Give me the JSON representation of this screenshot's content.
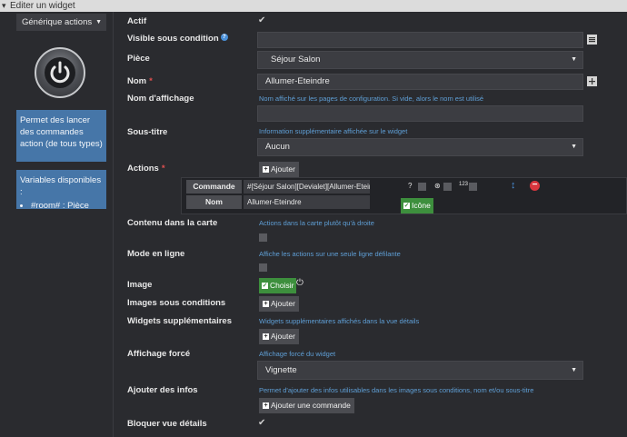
{
  "title": "Editer un widget",
  "sidebar": {
    "type_select": "Générique actions",
    "description": "Permet des lancer des commandes action (de tous types)",
    "variables_title": "Variables disponibles :",
    "variables": [
      "#room# : Pièce"
    ]
  },
  "form": {
    "actif": {
      "label": "Actif"
    },
    "visible": {
      "label": "Visible sous condition",
      "value": ""
    },
    "piece": {
      "label": "Pièce",
      "value": "Séjour Salon"
    },
    "nom": {
      "label": "Nom",
      "required": "*",
      "value": "Allumer-Eteindre"
    },
    "nom_affichage": {
      "label": "Nom d'affichage",
      "hint": "Nom affiché sur les pages de configuration. Si vide, alors le nom est utilisé",
      "value": ""
    },
    "sous_titre": {
      "label": "Sous-titre",
      "hint": "Information supplémentaire affichée sur le widget",
      "value": "Aucun"
    },
    "actions": {
      "label": "Actions",
      "required": "*",
      "add_label": "Ajouter",
      "commande_label": "Commande",
      "commande_value": "#[Séjour Salon][Devialet][Allumer-Eteindre]#",
      "nom_label": "Nom",
      "nom_value": "Allumer-Eteindre",
      "icone_label": "Icône",
      "count_label": "123"
    },
    "contenu": {
      "label": "Contenu dans la carte",
      "hint": "Actions dans la carte plutôt qu'à droite"
    },
    "mode_ligne": {
      "label": "Mode en ligne",
      "hint": "Affiche les actions sur une seule ligne défilante"
    },
    "image": {
      "label": "Image",
      "choose_label": "Choisir"
    },
    "images_cond": {
      "label": "Images sous conditions",
      "add_label": "Ajouter"
    },
    "widgets_supp": {
      "label": "Widgets supplémentaires",
      "hint": "Widgets supplémentaires affichés dans la vue détails",
      "add_label": "Ajouter"
    },
    "affichage": {
      "label": "Affichage forcé",
      "hint": "Affichage forcé du widget",
      "value": "Vignette"
    },
    "infos": {
      "label": "Ajouter des infos",
      "hint": "Permet d'ajouter des infos utilisables dans les images sous conditions, nom et/ou sous-titre",
      "add_label": "Ajouter une commande"
    },
    "bloquer": {
      "label": "Bloquer vue détails"
    }
  },
  "colors": {
    "background": "#2a2b2f",
    "info_box": "#4676a8",
    "hint": "#5f9fd6",
    "green": "#3d8f3d",
    "red": "#d9363e"
  }
}
